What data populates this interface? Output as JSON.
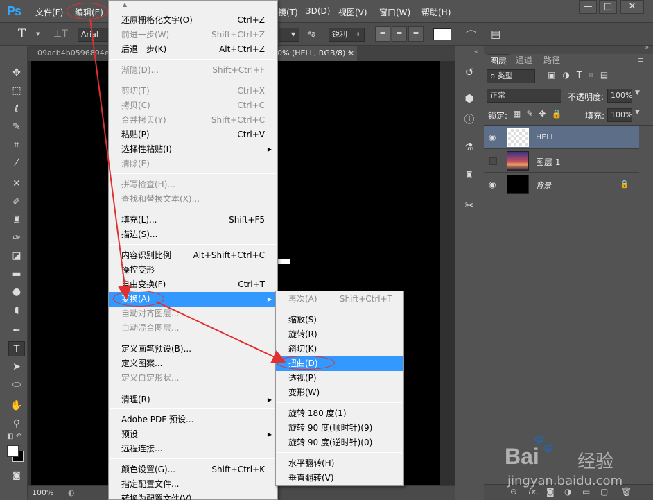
{
  "app_logo": "Ps",
  "menubar": {
    "items": [
      "文件(F)",
      "编辑(E)",
      "镜(T)",
      "3D(D)",
      "视图(V)",
      "窗口(W)",
      "帮助(H)"
    ],
    "window_buttons": [
      "—",
      "□",
      "✕"
    ]
  },
  "options": {
    "tool_glyph": "T",
    "font_family": "Arial",
    "aa_label": "ªa",
    "aa_mode": "锐利"
  },
  "tabs": {
    "doc1": "09acb4b0596894e",
    "doc2": "0% (HELL, RGB/8) *",
    "close": "×"
  },
  "status": {
    "zoom": "100%"
  },
  "layers_panel": {
    "tabs": [
      "图层",
      "通道",
      "路径"
    ],
    "filter_kind": "ρ 类型",
    "blend_mode": "正常",
    "opacity_label": "不透明度:",
    "opacity_value": "100%",
    "lock_label": "锁定:",
    "fill_label": "填充:",
    "fill_value": "100%",
    "layers": [
      {
        "name": "HELL",
        "visible": true,
        "selected": true
      },
      {
        "name": "图层 1",
        "visible": false,
        "selected": false
      },
      {
        "name": "背景",
        "visible": true,
        "selected": false,
        "locked": true
      }
    ],
    "footer_icons": [
      "link-icon",
      "fx-icon",
      "mask-icon",
      "adjustment-icon",
      "folder-icon",
      "new-layer-icon",
      "trash-icon"
    ],
    "footer_fx": "fx."
  },
  "edit_menu": {
    "scroll_up": "▲",
    "items": [
      {
        "label": "还原栅格化文字(O)",
        "shortcut": "Ctrl+Z",
        "disabled": false
      },
      {
        "label": "前进一步(W)",
        "shortcut": "Shift+Ctrl+Z",
        "disabled": true
      },
      {
        "label": "后退一步(K)",
        "shortcut": "Alt+Ctrl+Z",
        "disabled": false
      },
      {
        "label": "渐隐(D)...",
        "shortcut": "Shift+Ctrl+F",
        "disabled": true
      },
      {
        "label": "剪切(T)",
        "shortcut": "Ctrl+X",
        "disabled": true
      },
      {
        "label": "拷贝(C)",
        "shortcut": "Ctrl+C",
        "disabled": true
      },
      {
        "label": "合并拷贝(Y)",
        "shortcut": "Shift+Ctrl+C",
        "disabled": true
      },
      {
        "label": "粘贴(P)",
        "shortcut": "Ctrl+V",
        "disabled": false
      },
      {
        "label": "选择性粘贴(I)",
        "shortcut": "",
        "disabled": false,
        "submenu": true
      },
      {
        "label": "清除(E)",
        "shortcut": "",
        "disabled": true
      },
      {
        "label": "拼写检查(H)...",
        "shortcut": "",
        "disabled": true
      },
      {
        "label": "查找和替换文本(X)...",
        "shortcut": "",
        "disabled": true
      },
      {
        "label": "填充(L)...",
        "shortcut": "Shift+F5",
        "disabled": false
      },
      {
        "label": "描边(S)...",
        "shortcut": "",
        "disabled": false
      },
      {
        "label": "内容识别比例",
        "shortcut": "Alt+Shift+Ctrl+C",
        "disabled": false
      },
      {
        "label": "操控变形",
        "shortcut": "",
        "disabled": false
      },
      {
        "label": "自由变换(F)",
        "shortcut": "Ctrl+T",
        "disabled": false
      },
      {
        "label": "变换(A)",
        "shortcut": "",
        "disabled": false,
        "submenu": true,
        "highlighted": true
      },
      {
        "label": "自动对齐图层...",
        "shortcut": "",
        "disabled": true
      },
      {
        "label": "自动混合图层...",
        "shortcut": "",
        "disabled": true
      },
      {
        "label": "定义画笔预设(B)...",
        "shortcut": "",
        "disabled": false
      },
      {
        "label": "定义图案...",
        "shortcut": "",
        "disabled": false
      },
      {
        "label": "定义自定形状...",
        "shortcut": "",
        "disabled": true
      },
      {
        "label": "清理(R)",
        "shortcut": "",
        "disabled": false,
        "submenu": true
      },
      {
        "label": "Adobe PDF 预设...",
        "shortcut": "",
        "disabled": false
      },
      {
        "label": "预设",
        "shortcut": "",
        "disabled": false,
        "submenu": true
      },
      {
        "label": "远程连接...",
        "shortcut": "",
        "disabled": false
      },
      {
        "label": "颜色设置(G)...",
        "shortcut": "Shift+Ctrl+K",
        "disabled": false
      },
      {
        "label": "指定配置文件...",
        "shortcut": "",
        "disabled": false
      },
      {
        "label": "转换为配置文件(V)...",
        "shortcut": "",
        "disabled": false
      }
    ]
  },
  "transform_submenu": {
    "items": [
      {
        "label": "再次(A)",
        "shortcut": "Shift+Ctrl+T",
        "disabled": true
      },
      {
        "label": "缩放(S)",
        "shortcut": "",
        "disabled": false
      },
      {
        "label": "旋转(R)",
        "shortcut": "",
        "disabled": false
      },
      {
        "label": "斜切(K)",
        "shortcut": "",
        "disabled": false
      },
      {
        "label": "扭曲(D)",
        "shortcut": "",
        "disabled": false,
        "highlighted": true
      },
      {
        "label": "透视(P)",
        "shortcut": "",
        "disabled": false
      },
      {
        "label": "变形(W)",
        "shortcut": "",
        "disabled": false
      },
      {
        "label": "旋转 180 度(1)",
        "shortcut": "",
        "disabled": false
      },
      {
        "label": "旋转 90 度(顺时针)(9)",
        "shortcut": "",
        "disabled": false
      },
      {
        "label": "旋转 90 度(逆时针)(0)",
        "shortcut": "",
        "disabled": false
      },
      {
        "label": "水平翻转(H)",
        "shortcut": "",
        "disabled": false
      },
      {
        "label": "垂直翻转(V)",
        "shortcut": "",
        "disabled": false
      }
    ]
  },
  "watermark": {
    "logo_text": "Bai",
    "logo_suffix": "经验",
    "url": "jingyan.baidu.com"
  },
  "colors": {
    "highlight": "#3399ff",
    "annotation": "#e03030"
  }
}
